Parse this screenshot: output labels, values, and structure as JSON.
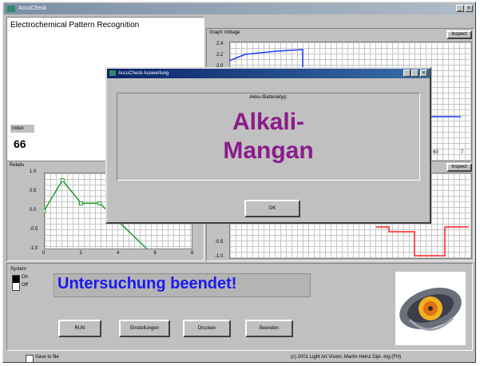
{
  "window": {
    "title": "AccuCheck",
    "min_label": "_",
    "close_label": "×"
  },
  "main": {
    "heading": "Electrochemical Pattern Recognition",
    "index_label": "Index",
    "index_value": "66",
    "relativ_label": "Relativ",
    "graph_label": "Graph Voltage",
    "inspect_top_label": "Inspect",
    "inspect_bottom_label": "Inspect"
  },
  "relativ_chart": {
    "type": "line",
    "x": [
      0,
      1,
      2,
      3,
      6
    ],
    "y": [
      0.0,
      0.8,
      0.2,
      0.2,
      -1.2
    ],
    "y_ticks": [
      "1.0",
      "0.5",
      "0.0",
      "-0.5",
      "-1.0"
    ],
    "x_ticks": [
      "0",
      "2",
      "4",
      "6",
      "8"
    ],
    "ylim": [
      -1.0,
      1.0
    ],
    "xlim": [
      0,
      8
    ],
    "color": "#1f9a2a"
  },
  "voltage_chart_top": {
    "type": "line",
    "y_ticks": [
      "2.4",
      "2.2",
      "2.0"
    ],
    "x_ticks": [
      "60",
      "7"
    ],
    "color": "#1a3cff"
  },
  "voltage_chart_bottom": {
    "type": "line",
    "y_ticks": [
      "-0.5",
      "-1.0"
    ],
    "color": "#ff2020"
  },
  "bottom": {
    "system_label": "System",
    "on_label": "On",
    "off_label": "Off",
    "status_text": "Untersuchung beendet!",
    "buttons": {
      "run": "RUN",
      "einstellungen": "Einstellungen",
      "drucken": "Drucken",
      "beenden": "Beenden"
    },
    "save_label": "Save to file",
    "copyright": "(c) 2001 Light Art Vision, Martin Heinz Dipl.-Ing.(FH)"
  },
  "dialog": {
    "title": "AccuCheck Auswertung",
    "label": "Akku-/Batterietyp:",
    "result_line1": "Alkali-",
    "result_line2": "Mangan",
    "ok_label": "OK",
    "result_color": "#8a1b8a"
  },
  "colors": {
    "status_blue": "#1a1aee",
    "face_gray": "#c0c0c0"
  }
}
